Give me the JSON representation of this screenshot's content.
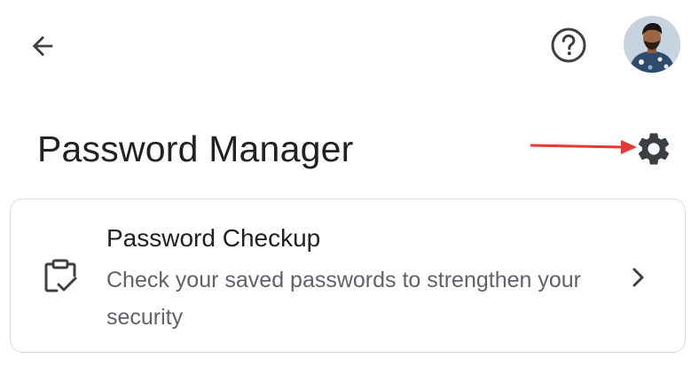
{
  "header": {
    "back_icon": "arrow-back-icon",
    "help_icon": "help-circle-icon",
    "avatar": "user-avatar"
  },
  "main": {
    "title": "Password Manager",
    "settings_icon": "gear-icon",
    "annotation_color": "#e53935"
  },
  "checkup_card": {
    "title": "Password Checkup",
    "description": "Check your saved passwords to strengthen your security",
    "icon": "clipboard-check-icon",
    "chevron_icon": "chevron-right-icon"
  },
  "colors": {
    "text_primary": "#202124",
    "text_secondary": "#5f6368",
    "card_border": "#dadce0",
    "icon": "#3c4043"
  }
}
